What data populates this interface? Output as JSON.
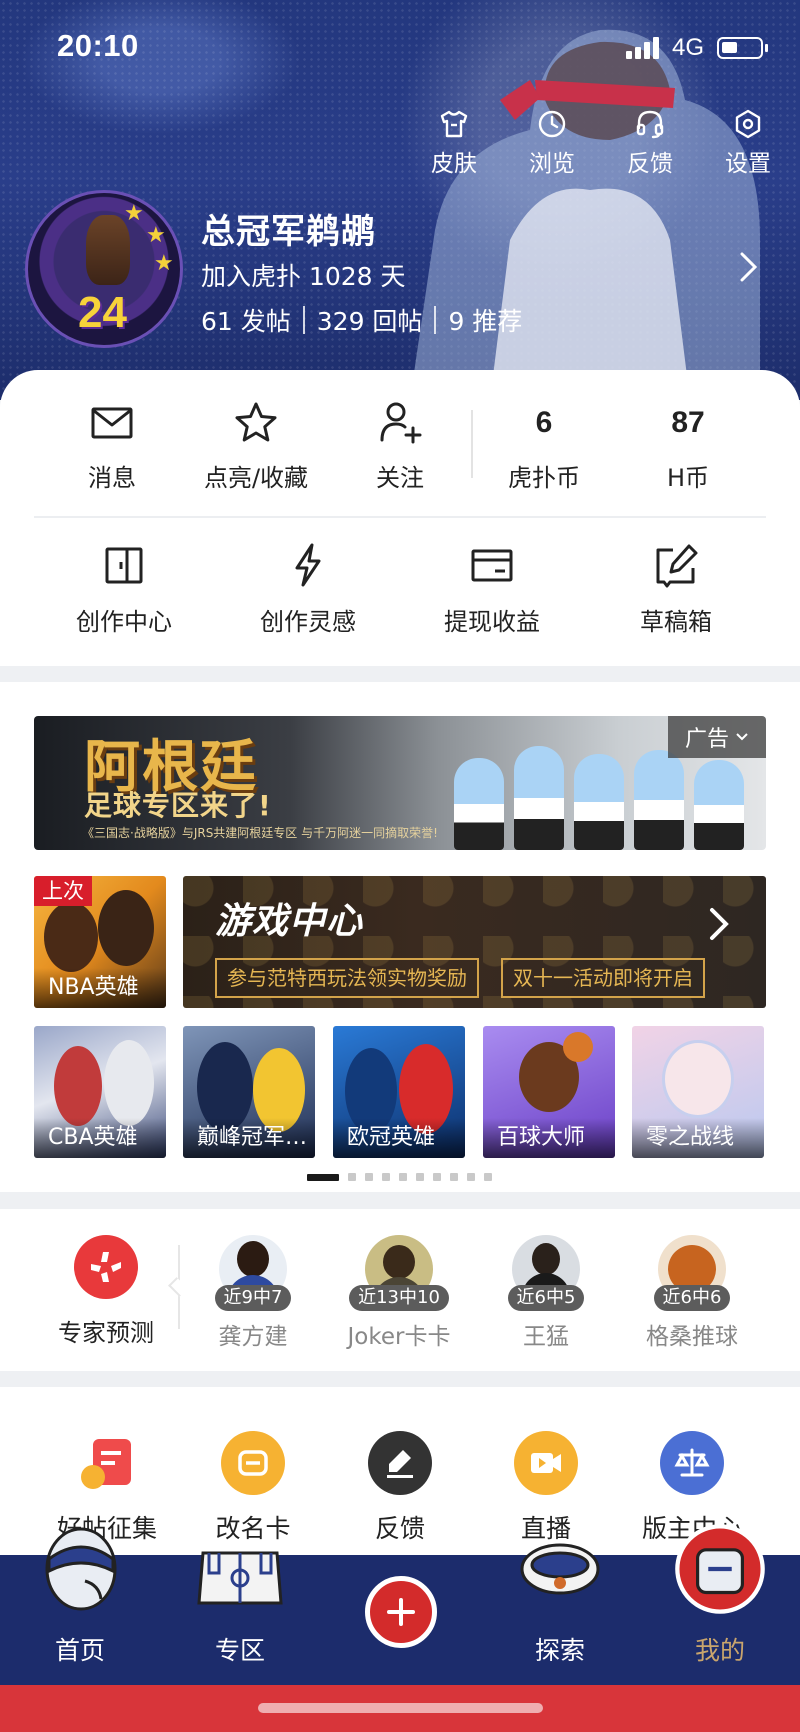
{
  "status_bar": {
    "time": "20:10",
    "network": "4G"
  },
  "header": {
    "actions": [
      {
        "label": "皮肤",
        "icon": "shirt-icon"
      },
      {
        "label": "浏览",
        "icon": "clock-icon"
      },
      {
        "label": "反馈",
        "icon": "headset-icon"
      },
      {
        "label": "设置",
        "icon": "gear-icon"
      }
    ],
    "avatar_badge": "24"
  },
  "profile": {
    "name": "总冠军鹈鹕",
    "joined": "加入虎扑 1028 天",
    "stats": [
      "61 发帖",
      "329 回帖",
      "9 推荐"
    ]
  },
  "quick_row": [
    {
      "label": "消息",
      "icon": "mail-icon"
    },
    {
      "label": "点亮/收藏",
      "icon": "star-icon"
    },
    {
      "label": "关注",
      "icon": "follow-icon"
    },
    {
      "label": "虎扑币",
      "value": "6"
    },
    {
      "label": "H币",
      "value": "87"
    }
  ],
  "creator_row": [
    {
      "label": "创作中心",
      "icon": "door-icon"
    },
    {
      "label": "创作灵感",
      "icon": "lightning-icon"
    },
    {
      "label": "提现收益",
      "icon": "wallet-icon"
    },
    {
      "label": "草稿箱",
      "icon": "edit-box-icon"
    }
  ],
  "ad_banner": {
    "title": "阿根廷",
    "subtitle": "足球专区来了!",
    "fineprint": "《三国志·战略版》与JRS共建阿根廷专区 与千万阿迷一同摘取荣誉!",
    "badge": "广告"
  },
  "games": {
    "featured": {
      "label": "NBA英雄",
      "tag": "上次"
    },
    "game_center": {
      "title": "游戏中心",
      "pills": [
        "参与范特西玩法领实物奖励",
        "双十一活动即将开启"
      ]
    },
    "tiles": [
      "CBA英雄",
      "巅峰冠军…",
      "欧冠英雄",
      "百球大师",
      "零之战线"
    ],
    "page_count": 10,
    "active_page": 1
  },
  "expert": {
    "label": "专家预测",
    "experts": [
      {
        "record": "近9中7",
        "name": "龚方建"
      },
      {
        "record": "近13中10",
        "name": "Joker卡卡"
      },
      {
        "record": "近6中5",
        "name": "王猛"
      },
      {
        "record": "近6中6",
        "name": "格桑推球"
      }
    ]
  },
  "services": [
    {
      "label": "好帖征集",
      "icon": "post-collect-icon",
      "color": "#ef4b4b"
    },
    {
      "label": "改名卡",
      "icon": "rename-card-icon",
      "color": "#f6b232"
    },
    {
      "label": "反馈",
      "icon": "pen-icon",
      "color": "#333333"
    },
    {
      "label": "直播",
      "icon": "live-video-icon",
      "color": "#f6b232"
    },
    {
      "label": "版主中心",
      "icon": "scales-icon",
      "color": "#4b6fd4"
    }
  ],
  "tabs": [
    {
      "label": "首页",
      "icon": "home-mascot-icon",
      "active": false
    },
    {
      "label": "专区",
      "icon": "court-icon",
      "active": false
    },
    {
      "label": "探索",
      "icon": "headband-icon",
      "active": false
    },
    {
      "label": "我的",
      "icon": "jersey-icon",
      "active": true
    }
  ],
  "colors": {
    "header_blue": "#23377e",
    "tab_bar": "#1c2c6c",
    "accent_red": "#d32b2b",
    "active_tab_gold": "#c9a56d"
  }
}
